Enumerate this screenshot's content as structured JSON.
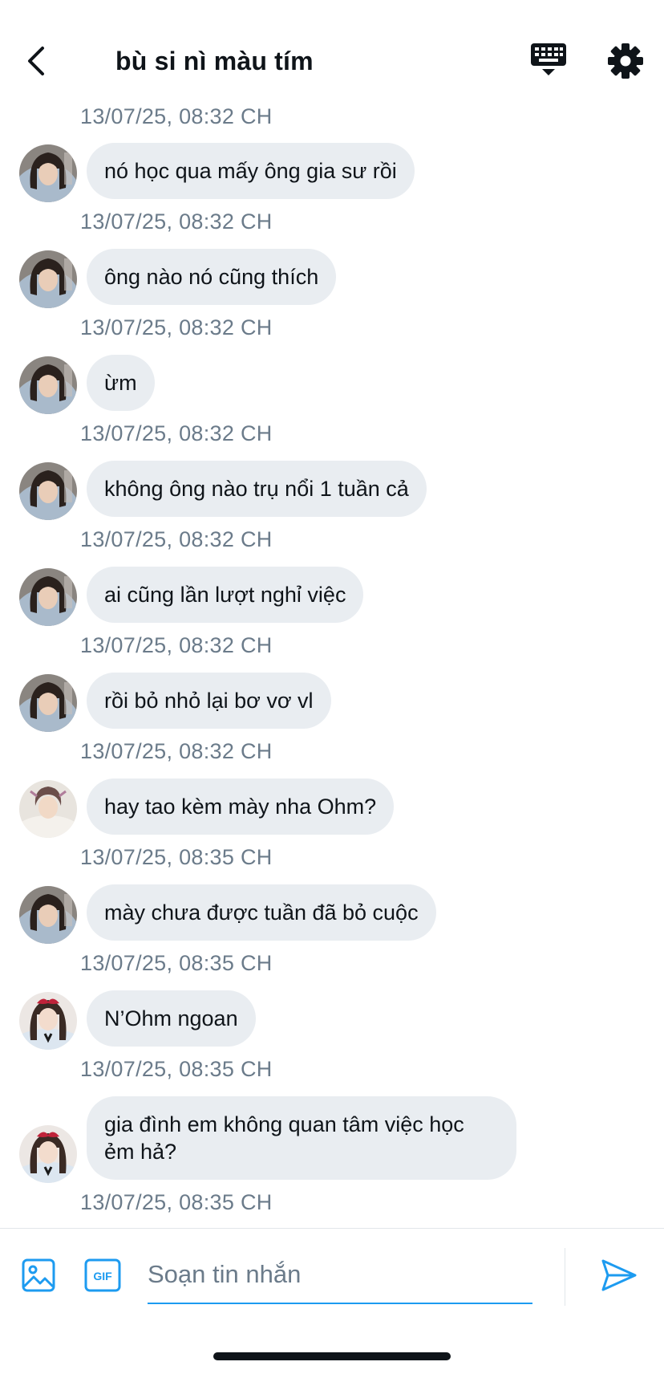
{
  "header": {
    "title": "bù si nì màu tím",
    "icons": [
      "back-chevron-icon",
      "keyboard-icon",
      "gear-icon"
    ]
  },
  "top_timestamp": "13/07/25, 08:32 CH",
  "messages": [
    {
      "avatar": "woman-dark-hair",
      "text": "nó học qua mấy ông gia sư rồi",
      "time": "13/07/25, 08:32 CH"
    },
    {
      "avatar": "woman-dark-hair",
      "text": "ông nào nó cũng thích",
      "time": "13/07/25, 08:32 CH"
    },
    {
      "avatar": "woman-dark-hair",
      "text": "ừm",
      "time": "13/07/25, 08:32 CH"
    },
    {
      "avatar": "woman-dark-hair",
      "text": "không ông nào trụ nổi 1 tuần cả",
      "time": "13/07/25, 08:32 CH"
    },
    {
      "avatar": "woman-dark-hair",
      "text": "ai cũng lần lượt nghỉ việc",
      "time": "13/07/25, 08:32 CH"
    },
    {
      "avatar": "woman-dark-hair",
      "text": "rồi bỏ nhỏ lại bơ vơ vl",
      "time": "13/07/25, 08:32 CH"
    },
    {
      "avatar": "young-man-light",
      "text": "hay tao kèm mày nha Ohm?",
      "time": "13/07/25, 08:35 CH"
    },
    {
      "avatar": "woman-dark-hair",
      "text": "mày chưa được tuần đã bỏ cuộc",
      "time": "13/07/25, 08:35 CH"
    },
    {
      "avatar": "girl-red-bow",
      "text": "N’Ohm ngoan",
      "time": "13/07/25, 08:35 CH"
    },
    {
      "avatar": "girl-red-bow",
      "text": "gia đình em không quan tâm việc học ẻm hả?",
      "time": "13/07/25, 08:35 CH"
    }
  ],
  "composer": {
    "placeholder": "Soạn tin nhắn",
    "value": "",
    "gif_label": "GIF",
    "icons": [
      "image-icon",
      "gif-icon",
      "send-icon"
    ]
  },
  "colors": {
    "accent": "#1d9bf0",
    "bubble": "#e9edf1",
    "timestamp": "#6b7b8a",
    "text": "#0f1419"
  }
}
